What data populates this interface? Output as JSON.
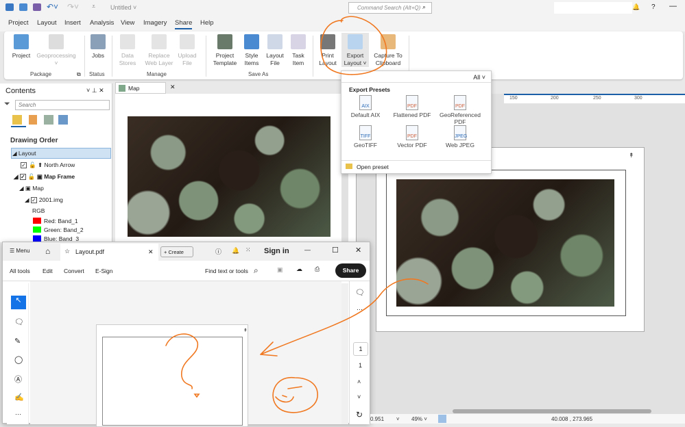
{
  "app": {
    "title": "Untitled",
    "command_search_placeholder": "Command Search (Alt+Q)",
    "help": "?"
  },
  "tabs": [
    "Project",
    "Layout",
    "Insert",
    "Analysis",
    "View",
    "Imagery",
    "Share",
    "Help"
  ],
  "active_tab": "Share",
  "ribbon": {
    "groups": [
      {
        "label": "Package",
        "items": [
          {
            "label": "Project"
          },
          {
            "label": "Geoprocessing",
            "disabled": true
          }
        ]
      },
      {
        "label": "Status",
        "items": [
          {
            "label": "Jobs"
          }
        ]
      },
      {
        "label": "Manage",
        "items": [
          {
            "label": "Data Stores",
            "disabled": true
          },
          {
            "label": "Replace Web Layer",
            "disabled": true
          },
          {
            "label": "Upload File",
            "disabled": true
          }
        ]
      },
      {
        "label": "Save As",
        "items": [
          {
            "label": "Project Template"
          },
          {
            "label": "Style Items"
          },
          {
            "label": "Layout File"
          },
          {
            "label": "Task Item"
          }
        ]
      },
      {
        "label": "",
        "items": [
          {
            "label": "Print Layout"
          },
          {
            "label": "Export Layout"
          },
          {
            "label": "Capture To Clipboard"
          }
        ]
      }
    ]
  },
  "contents": {
    "title": "Contents",
    "search_placeholder": "Search",
    "section": "Drawing Order",
    "tree": [
      "Layout",
      "North Arrow",
      "Map Frame",
      "Map",
      "2001.img",
      "RGB"
    ],
    "bands": [
      {
        "label": "Red:  Band_1",
        "color": "#ff0000"
      },
      {
        "label": "Green: Band_2",
        "color": "#00ff00"
      },
      {
        "label": "Blue:  Band_3",
        "color": "#0000ff"
      }
    ]
  },
  "map_tab": {
    "label": "Map"
  },
  "ruler": [
    "150",
    "200",
    "250",
    "300"
  ],
  "export_menu": {
    "filter": "All",
    "section": "Export Presets",
    "presets": [
      {
        "label": "Default AIX",
        "type": "AIX"
      },
      {
        "label": "Flattened PDF",
        "type": "PDF"
      },
      {
        "label": "GeoReferenced PDF",
        "type": "PDF"
      },
      {
        "label": "GeoTIFF",
        "type": "TIFF"
      },
      {
        "label": "Vector PDF",
        "type": "PDF"
      },
      {
        "label": "Web JPEG",
        "type": "JPEG"
      }
    ],
    "open_preset": "Open preset"
  },
  "pdf_viewer": {
    "menu": "Menu",
    "tab": "Layout.pdf",
    "create": "Create",
    "sign_in": "Sign in",
    "toolbar": [
      "All tools",
      "Edit",
      "Convert",
      "E-Sign"
    ],
    "find": "Find text or tools",
    "share": "Share",
    "page_current": "1",
    "page_total": "1"
  },
  "status": {
    "scale": "0.951",
    "zoom": "49%",
    "coords": "40.008 , 273.965"
  },
  "colors": {
    "accent": "#1a5ea8",
    "annotation": "#f07820"
  }
}
